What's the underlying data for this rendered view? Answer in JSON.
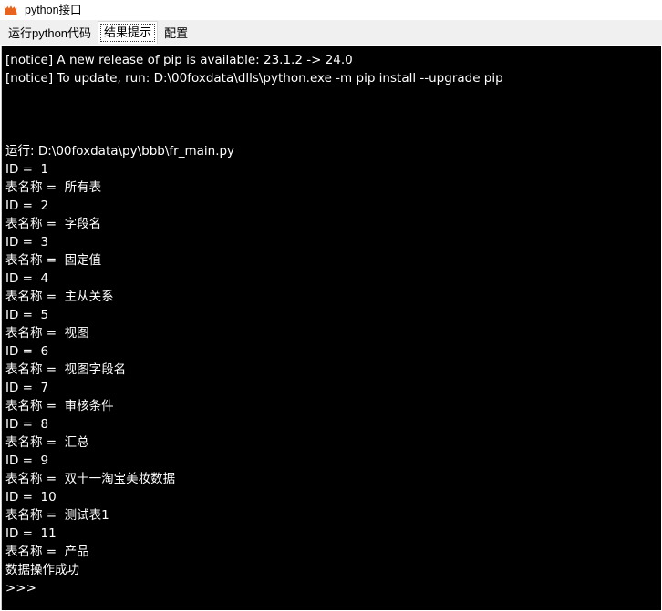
{
  "window": {
    "title": "python接口",
    "icon": "fox-icon",
    "icon_color": "#E8641E",
    "background_color": "#ffffff"
  },
  "tabs": {
    "items": [
      {
        "label": "运行python代码",
        "selected": false
      },
      {
        "label": "结果提示",
        "selected": true
      },
      {
        "label": "配置",
        "selected": false
      }
    ],
    "strip_color": "#f0f0f0"
  },
  "console": {
    "background_color": "#000000",
    "text_color": "#ffffff",
    "lines": [
      "[notice] A new release of pip is available: 23.1.2 -> 24.0",
      "[notice] To update, run: D:\\00foxdata\\dlls\\python.exe -m pip install --upgrade pip",
      "",
      "",
      "",
      "运行: D:\\00foxdata\\py\\bbb\\fr_main.py",
      "ID =  1",
      "表名称 =  所有表",
      "ID =  2",
      "表名称 =  字段名",
      "ID =  3",
      "表名称 =  固定值",
      "ID =  4",
      "表名称 =  主从关系",
      "ID =  5",
      "表名称 =  视图",
      "ID =  6",
      "表名称 =  视图字段名",
      "ID =  7",
      "表名称 =  审核条件",
      "ID =  8",
      "表名称 =  汇总",
      "ID =  9",
      "表名称 =  双十一淘宝美妆数据",
      "ID =  10",
      "表名称 =  测试表1",
      "ID =  11",
      "表名称 =  产品",
      "数据操作成功",
      ">>>"
    ],
    "prompt": ">>>",
    "status_message": "数据操作成功",
    "script_path": "D:\\00foxdata\\py\\bbb\\fr_main.py",
    "records": [
      {
        "id": "1",
        "table_name": "所有表"
      },
      {
        "id": "2",
        "table_name": "字段名"
      },
      {
        "id": "3",
        "table_name": "固定值"
      },
      {
        "id": "4",
        "table_name": "主从关系"
      },
      {
        "id": "5",
        "table_name": "视图"
      },
      {
        "id": "6",
        "table_name": "视图字段名"
      },
      {
        "id": "7",
        "table_name": "审核条件"
      },
      {
        "id": "8",
        "table_name": "汇总"
      },
      {
        "id": "9",
        "table_name": "双十一淘宝美妆数据"
      },
      {
        "id": "10",
        "table_name": "测试表1"
      },
      {
        "id": "11",
        "table_name": "产品"
      }
    ],
    "pip_notices": [
      "[notice] A new release of pip is available: 23.1.2 -> 24.0",
      "[notice] To update, run: D:\\00foxdata\\dlls\\python.exe -m pip install --upgrade pip"
    ]
  }
}
